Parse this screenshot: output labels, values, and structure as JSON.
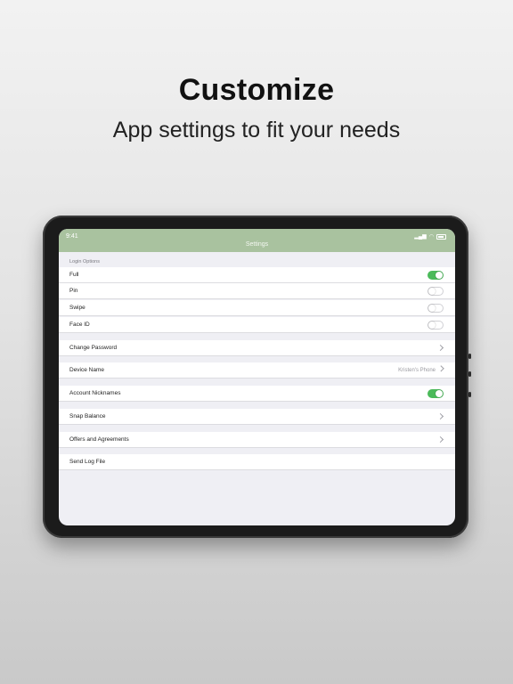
{
  "headline": "Customize",
  "subheadline": "App settings to fit your needs",
  "device": {
    "status_time": "9:41",
    "nav_title": "Settings"
  },
  "settings": {
    "login_section_header": "Login Options",
    "login_options": [
      {
        "label": "Full",
        "toggle": true
      },
      {
        "label": "Pin",
        "toggle": false
      },
      {
        "label": "Swipe",
        "toggle": false
      },
      {
        "label": "Face ID",
        "toggle": false
      }
    ],
    "change_password": "Change Password",
    "device_name": {
      "label": "Device Name",
      "value": "Kristen's Phone"
    },
    "account_nicknames": {
      "label": "Account Nicknames",
      "toggle": true
    },
    "snap_balance": "Snap Balance",
    "offers_agreements": "Offers and Agreements",
    "send_log_file": "Send Log File"
  },
  "colors": {
    "nav_bar": "#a9c29f",
    "toggle_on": "#4bba5a",
    "background": "#efeff4"
  }
}
